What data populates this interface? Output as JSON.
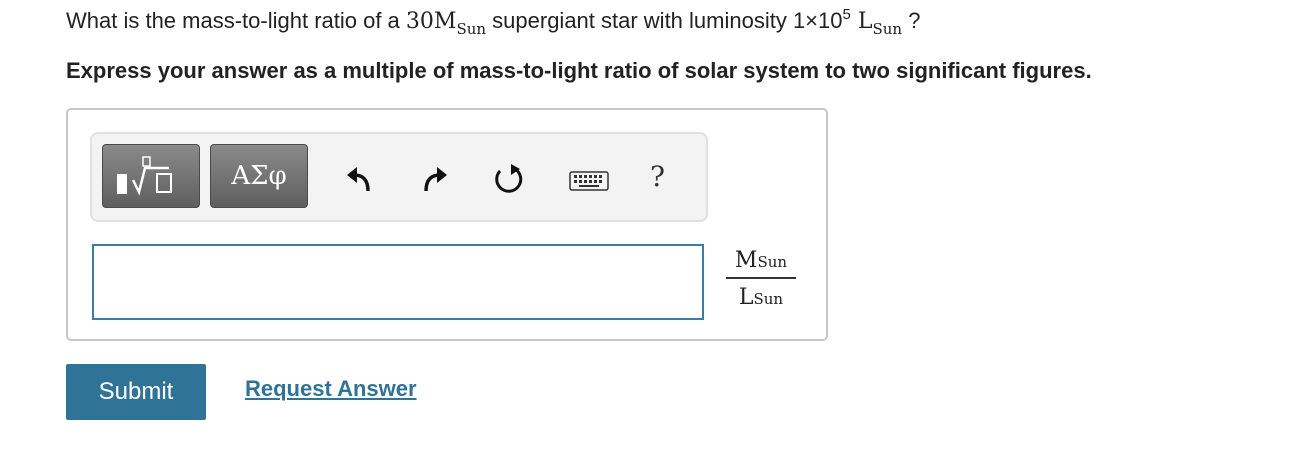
{
  "question": {
    "prefix": "What is the mass-to-light ratio of a ",
    "mass_value": "30M",
    "mass_sub": "Sun",
    "middle": " supergiant star with luminosity 1×10",
    "exponent": "5",
    "lum_symbol": " L",
    "lum_sub": "Sun",
    "suffix": " ?"
  },
  "instruction": "Express your answer as a multiple of mass-to-light ratio of solar system to two significant figures.",
  "toolbar": {
    "symbols_label": "ΑΣφ",
    "help_label": "?"
  },
  "answer": {
    "value": "",
    "unit_numerator": "M",
    "unit_numerator_sub": "Sun",
    "unit_denominator": "L",
    "unit_denominator_sub": "Sun"
  },
  "actions": {
    "submit_label": "Submit",
    "request_label": "Request Answer"
  },
  "colors": {
    "accent": "#2f7496",
    "input_border": "#3d7da3"
  }
}
